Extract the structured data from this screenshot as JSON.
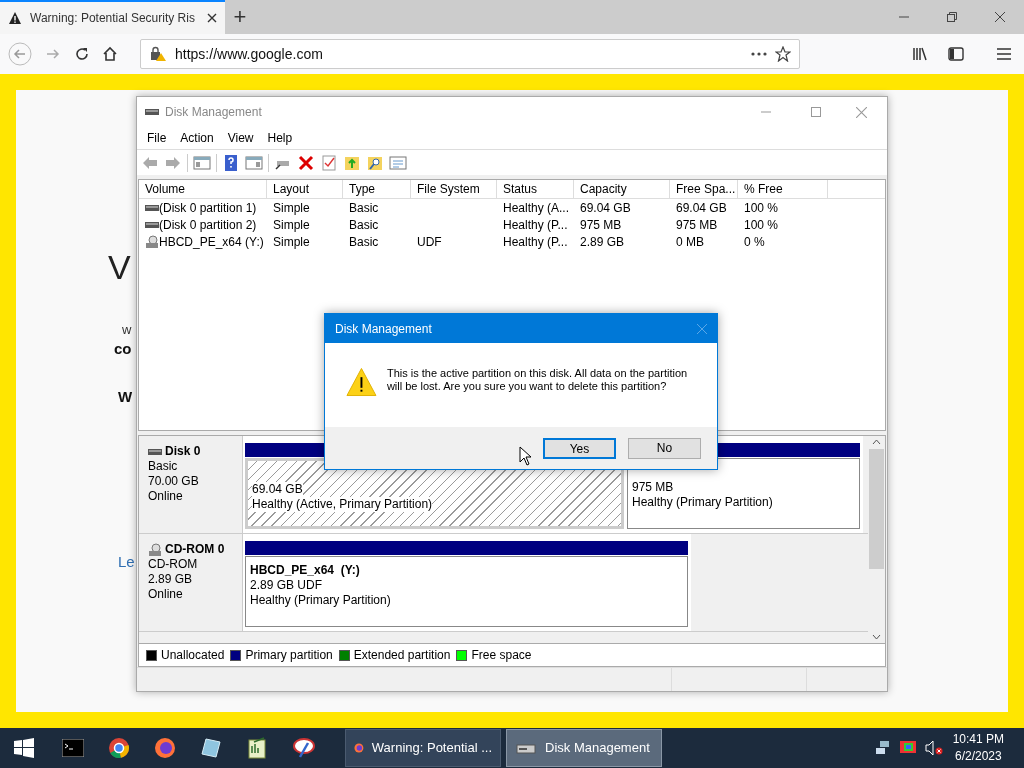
{
  "browser": {
    "tab": {
      "title": "Warning: Potential Security Ris",
      "selected": true
    },
    "new_tab": "+",
    "url": "https://www.google.com"
  },
  "page_fragments": [
    {
      "text": "V",
      "kind": "heading"
    },
    {
      "text": "w",
      "kind": "small"
    },
    {
      "text": "co",
      "kind": "bold"
    },
    {
      "text": "W",
      "kind": "bold"
    },
    {
      "text": "Le",
      "kind": "link"
    }
  ],
  "disk_management": {
    "title": "Disk Management",
    "menu": [
      "File",
      "Action",
      "View",
      "Help"
    ],
    "volumes": {
      "columns": [
        "Volume",
        "Layout",
        "Type",
        "File System",
        "Status",
        "Capacity",
        "Free Spa...",
        "% Free"
      ],
      "rows": [
        {
          "kind": "disk",
          "cells": [
            "(Disk 0 partition 1)",
            "Simple",
            "Basic",
            "",
            "Healthy (A...",
            "69.04 GB",
            "69.04 GB",
            "100 %"
          ]
        },
        {
          "kind": "disk",
          "cells": [
            "(Disk 0 partition 2)",
            "Simple",
            "Basic",
            "",
            "Healthy (P...",
            "975 MB",
            "975 MB",
            "100 %"
          ]
        },
        {
          "kind": "cdrom",
          "cells": [
            "HBCD_PE_x64 (Y:)",
            "Simple",
            "Basic",
            "UDF",
            "Healthy (P...",
            "2.89 GB",
            "0 MB",
            "0 %"
          ]
        }
      ]
    },
    "disks": [
      {
        "kind": "disk",
        "name": "Disk 0",
        "type": "Basic",
        "size": "70.00 GB",
        "status": "Online",
        "partitions": [
          {
            "size": "69.04 GB",
            "status": "Healthy (Active, Primary Partition)",
            "selected": true
          },
          {
            "size": "975 MB",
            "status": "Healthy (Primary Partition)",
            "selected": false
          }
        ]
      },
      {
        "kind": "cdrom",
        "name": "CD-ROM 0",
        "type": "CD-ROM",
        "size": "2.89 GB",
        "status": "Online",
        "partitions": [
          {
            "name": "HBCD_PE_x64  (Y:)",
            "size": "2.89 GB UDF",
            "status": "Healthy (Primary Partition)",
            "selected": false
          }
        ]
      }
    ],
    "legend": [
      {
        "label": "Unallocated",
        "color": "#000000"
      },
      {
        "label": "Primary partition",
        "color": "#000080"
      },
      {
        "label": "Extended partition",
        "color": "#008000"
      },
      {
        "label": "Free space",
        "color": "#00ff00"
      }
    ]
  },
  "dialog": {
    "title": "Disk Management",
    "message": "This is the active partition on this disk. All data on the partition will be lost. Are you sure you want to delete this partition?",
    "buttons": [
      {
        "label": "Yes",
        "selected": true
      },
      {
        "label": "No",
        "selected": false
      }
    ]
  },
  "taskbar": {
    "apps": [
      {
        "label": "Warning: Potential ...",
        "kind": "firefox",
        "selected": false
      },
      {
        "label": "Disk Management",
        "kind": "disk",
        "selected": true
      }
    ],
    "time": "10:41 PM",
    "date": "6/2/2023"
  }
}
